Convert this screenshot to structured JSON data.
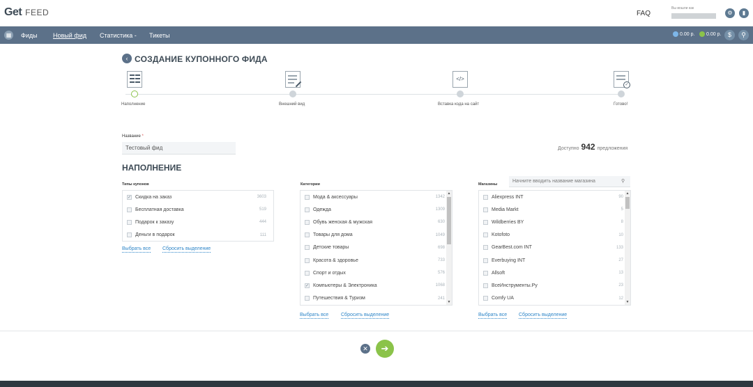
{
  "header": {
    "logo_get": "Get",
    "logo_feed": "FEED",
    "faq": "FAQ",
    "user_caption": "Вы вошли как"
  },
  "nav": {
    "items": [
      "Фиды",
      "Новый фид",
      "Статистика -",
      "Тикеты"
    ],
    "balance1": "0.00 р.",
    "balance2": "0.00 р."
  },
  "page": {
    "title": "СОЗДАНИЕ КУПОННОГО ФИДА"
  },
  "steps": [
    "Наполнение",
    "Внешний вид",
    "Вставка кода на сайт",
    "Готово!"
  ],
  "form": {
    "name_label": "Название",
    "name_required": "*",
    "name_value": "Тестовый фид",
    "available_prefix": "Доступно",
    "available_count": "942",
    "available_suffix": "предложения"
  },
  "section_title": "НАПОЛНЕНИЕ",
  "coupon_types": {
    "caption": "Типы купонов",
    "items": [
      {
        "label": "Скидка на заказ",
        "count": "3603",
        "checked": true
      },
      {
        "label": "Бесплатная доставка",
        "count": "519",
        "checked": false
      },
      {
        "label": "Подарок к заказу",
        "count": "444",
        "checked": false
      },
      {
        "label": "Деньги в подарок",
        "count": "111",
        "checked": false
      }
    ],
    "select_all": "Выбрать все",
    "reset": "Сбросить выделение"
  },
  "categories": {
    "caption": "Категории",
    "items": [
      {
        "label": "Мода & аксессуары",
        "count": "1342",
        "checked": false
      },
      {
        "label": "Одежда",
        "count": "1309",
        "checked": false
      },
      {
        "label": "Обувь женская & мужская",
        "count": "630",
        "checked": false
      },
      {
        "label": "Товары для дома",
        "count": "1049",
        "checked": false
      },
      {
        "label": "Детские товары",
        "count": "698",
        "checked": false
      },
      {
        "label": "Красота & здоровье",
        "count": "733",
        "checked": false
      },
      {
        "label": "Спорт и отдых",
        "count": "576",
        "checked": false
      },
      {
        "label": "Компьютеры & Электроника",
        "count": "1068",
        "checked": true
      },
      {
        "label": "Путешествия & Туризм",
        "count": "241",
        "checked": false
      }
    ],
    "select_all": "Выбрать все",
    "reset": "Сбросить выделение"
  },
  "shops": {
    "caption": "Магазины",
    "search_placeholder": "Начните вводить название магазина",
    "items": [
      {
        "label": "Aliexpress INT",
        "count": "90",
        "checked": false
      },
      {
        "label": "Media Markt",
        "count": "5",
        "checked": false
      },
      {
        "label": "Wildberries BY",
        "count": "8",
        "checked": false
      },
      {
        "label": "Kotofoto",
        "count": "10",
        "checked": false
      },
      {
        "label": "GearBest.com INT",
        "count": "133",
        "checked": false
      },
      {
        "label": "Everbuying INT",
        "count": "27",
        "checked": false
      },
      {
        "label": "Allsoft",
        "count": "13",
        "checked": false
      },
      {
        "label": "ВсеИнструменты.Ру",
        "count": "23",
        "checked": false
      },
      {
        "label": "Comfy UA",
        "count": "12",
        "checked": false
      }
    ],
    "select_all": "Выбрать все",
    "reset": "Сбросить выделение"
  },
  "colors": {
    "nav": "#5c7189",
    "accent_green": "#8bc34a",
    "link": "#2f86c8"
  }
}
